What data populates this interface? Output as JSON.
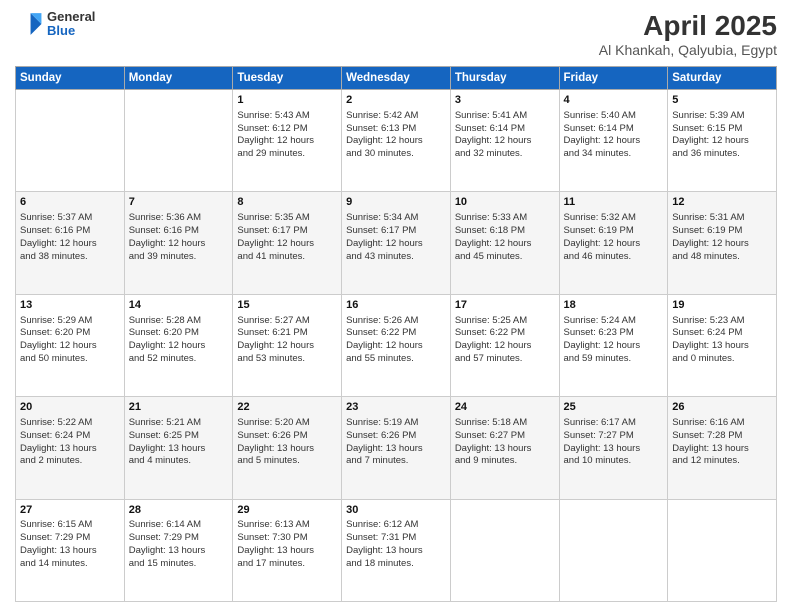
{
  "header": {
    "logo": {
      "line1": "General",
      "line2": "Blue"
    },
    "title": "April 2025",
    "location": "Al Khankah, Qalyubia, Egypt"
  },
  "days_of_week": [
    "Sunday",
    "Monday",
    "Tuesday",
    "Wednesday",
    "Thursday",
    "Friday",
    "Saturday"
  ],
  "weeks": [
    [
      {
        "day": "",
        "lines": []
      },
      {
        "day": "",
        "lines": []
      },
      {
        "day": "1",
        "lines": [
          "Sunrise: 5:43 AM",
          "Sunset: 6:12 PM",
          "Daylight: 12 hours",
          "and 29 minutes."
        ]
      },
      {
        "day": "2",
        "lines": [
          "Sunrise: 5:42 AM",
          "Sunset: 6:13 PM",
          "Daylight: 12 hours",
          "and 30 minutes."
        ]
      },
      {
        "day": "3",
        "lines": [
          "Sunrise: 5:41 AM",
          "Sunset: 6:14 PM",
          "Daylight: 12 hours",
          "and 32 minutes."
        ]
      },
      {
        "day": "4",
        "lines": [
          "Sunrise: 5:40 AM",
          "Sunset: 6:14 PM",
          "Daylight: 12 hours",
          "and 34 minutes."
        ]
      },
      {
        "day": "5",
        "lines": [
          "Sunrise: 5:39 AM",
          "Sunset: 6:15 PM",
          "Daylight: 12 hours",
          "and 36 minutes."
        ]
      }
    ],
    [
      {
        "day": "6",
        "lines": [
          "Sunrise: 5:37 AM",
          "Sunset: 6:16 PM",
          "Daylight: 12 hours",
          "and 38 minutes."
        ]
      },
      {
        "day": "7",
        "lines": [
          "Sunrise: 5:36 AM",
          "Sunset: 6:16 PM",
          "Daylight: 12 hours",
          "and 39 minutes."
        ]
      },
      {
        "day": "8",
        "lines": [
          "Sunrise: 5:35 AM",
          "Sunset: 6:17 PM",
          "Daylight: 12 hours",
          "and 41 minutes."
        ]
      },
      {
        "day": "9",
        "lines": [
          "Sunrise: 5:34 AM",
          "Sunset: 6:17 PM",
          "Daylight: 12 hours",
          "and 43 minutes."
        ]
      },
      {
        "day": "10",
        "lines": [
          "Sunrise: 5:33 AM",
          "Sunset: 6:18 PM",
          "Daylight: 12 hours",
          "and 45 minutes."
        ]
      },
      {
        "day": "11",
        "lines": [
          "Sunrise: 5:32 AM",
          "Sunset: 6:19 PM",
          "Daylight: 12 hours",
          "and 46 minutes."
        ]
      },
      {
        "day": "12",
        "lines": [
          "Sunrise: 5:31 AM",
          "Sunset: 6:19 PM",
          "Daylight: 12 hours",
          "and 48 minutes."
        ]
      }
    ],
    [
      {
        "day": "13",
        "lines": [
          "Sunrise: 5:29 AM",
          "Sunset: 6:20 PM",
          "Daylight: 12 hours",
          "and 50 minutes."
        ]
      },
      {
        "day": "14",
        "lines": [
          "Sunrise: 5:28 AM",
          "Sunset: 6:20 PM",
          "Daylight: 12 hours",
          "and 52 minutes."
        ]
      },
      {
        "day": "15",
        "lines": [
          "Sunrise: 5:27 AM",
          "Sunset: 6:21 PM",
          "Daylight: 12 hours",
          "and 53 minutes."
        ]
      },
      {
        "day": "16",
        "lines": [
          "Sunrise: 5:26 AM",
          "Sunset: 6:22 PM",
          "Daylight: 12 hours",
          "and 55 minutes."
        ]
      },
      {
        "day": "17",
        "lines": [
          "Sunrise: 5:25 AM",
          "Sunset: 6:22 PM",
          "Daylight: 12 hours",
          "and 57 minutes."
        ]
      },
      {
        "day": "18",
        "lines": [
          "Sunrise: 5:24 AM",
          "Sunset: 6:23 PM",
          "Daylight: 12 hours",
          "and 59 minutes."
        ]
      },
      {
        "day": "19",
        "lines": [
          "Sunrise: 5:23 AM",
          "Sunset: 6:24 PM",
          "Daylight: 13 hours",
          "and 0 minutes."
        ]
      }
    ],
    [
      {
        "day": "20",
        "lines": [
          "Sunrise: 5:22 AM",
          "Sunset: 6:24 PM",
          "Daylight: 13 hours",
          "and 2 minutes."
        ]
      },
      {
        "day": "21",
        "lines": [
          "Sunrise: 5:21 AM",
          "Sunset: 6:25 PM",
          "Daylight: 13 hours",
          "and 4 minutes."
        ]
      },
      {
        "day": "22",
        "lines": [
          "Sunrise: 5:20 AM",
          "Sunset: 6:26 PM",
          "Daylight: 13 hours",
          "and 5 minutes."
        ]
      },
      {
        "day": "23",
        "lines": [
          "Sunrise: 5:19 AM",
          "Sunset: 6:26 PM",
          "Daylight: 13 hours",
          "and 7 minutes."
        ]
      },
      {
        "day": "24",
        "lines": [
          "Sunrise: 5:18 AM",
          "Sunset: 6:27 PM",
          "Daylight: 13 hours",
          "and 9 minutes."
        ]
      },
      {
        "day": "25",
        "lines": [
          "Sunrise: 6:17 AM",
          "Sunset: 7:27 PM",
          "Daylight: 13 hours",
          "and 10 minutes."
        ]
      },
      {
        "day": "26",
        "lines": [
          "Sunrise: 6:16 AM",
          "Sunset: 7:28 PM",
          "Daylight: 13 hours",
          "and 12 minutes."
        ]
      }
    ],
    [
      {
        "day": "27",
        "lines": [
          "Sunrise: 6:15 AM",
          "Sunset: 7:29 PM",
          "Daylight: 13 hours",
          "and 14 minutes."
        ]
      },
      {
        "day": "28",
        "lines": [
          "Sunrise: 6:14 AM",
          "Sunset: 7:29 PM",
          "Daylight: 13 hours",
          "and 15 minutes."
        ]
      },
      {
        "day": "29",
        "lines": [
          "Sunrise: 6:13 AM",
          "Sunset: 7:30 PM",
          "Daylight: 13 hours",
          "and 17 minutes."
        ]
      },
      {
        "day": "30",
        "lines": [
          "Sunrise: 6:12 AM",
          "Sunset: 7:31 PM",
          "Daylight: 13 hours",
          "and 18 minutes."
        ]
      },
      {
        "day": "",
        "lines": []
      },
      {
        "day": "",
        "lines": []
      },
      {
        "day": "",
        "lines": []
      }
    ]
  ]
}
